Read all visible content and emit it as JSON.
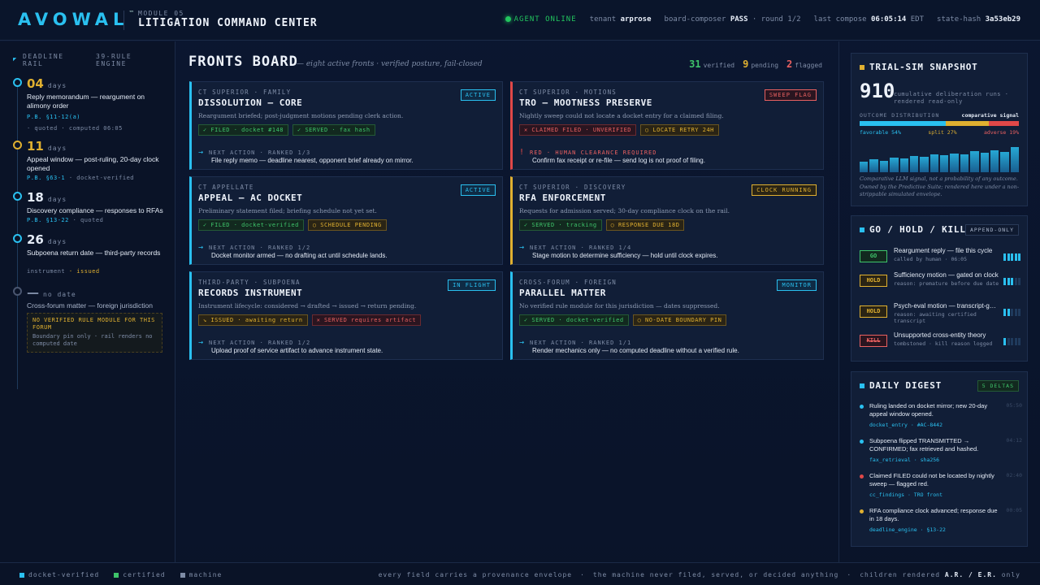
{
  "header": {
    "logo": "AVOWAL",
    "logo_mark": "™",
    "module": "MODULE 05",
    "title": "LITIGATION COMMAND CENTER",
    "agent_status": "AGENT ONLINE",
    "tenant_label": "tenant",
    "tenant": "arprose",
    "composer_label": "board-composer",
    "composer": "PASS",
    "round": "· round 1/2",
    "compose_label": "last compose",
    "compose_time": "06:05:14",
    "compose_tz": "EDT",
    "hash_label": "state-hash",
    "hash": "3a53eb29"
  },
  "rail": {
    "label_a": "DEADLINE RAIL",
    "label_b": "39-RULE ENGINE",
    "deadlines": [
      {
        "days": "04",
        "unit": "days",
        "color": "#e0b030",
        "node": "#2ac0f0",
        "title": "Reply memorandum — reargument on alimony order",
        "rule": "P.B. §11-12(a)",
        "meta": "· quoted · computed 06:05"
      },
      {
        "days": "11",
        "unit": "days",
        "color": "#e0b030",
        "node": "#e0b030",
        "title": "Appeal window — post-ruling, 20-day clock opened",
        "rule": "P.B. §63-1",
        "meta": "· docket-verified"
      },
      {
        "days": "18",
        "unit": "days",
        "color": "#e4ebf6",
        "node": "#2ac0f0",
        "title": "Discovery compliance — responses to RFAs",
        "rule": "P.B. §13-22",
        "meta": "· quoted"
      },
      {
        "days": "26",
        "unit": "days",
        "color": "#e4ebf6",
        "node": "#2ac0f0",
        "title": "Subpoena return date — third-party records",
        "rule": "instrument",
        "meta": "· issued"
      }
    ],
    "nodate": {
      "dash": "—",
      "unit": "no date",
      "title": "Cross-forum matter — foreign jurisdiction",
      "box_title": "NO VERIFIED RULE MODULE FOR THIS FORUM",
      "box_sub": "Boundary pin only · rail renders no computed date"
    }
  },
  "board": {
    "title": "FRONTS BOARD",
    "subtitle": "— eight active fronts · verified posture, fail-closed",
    "verified_n": "31",
    "verified_l": "verified",
    "pending_n": "9",
    "pending_l": "pending",
    "flagged_n": "2",
    "flagged_l": "flagged",
    "cards": [
      {
        "court": "CT SUPERIOR · FAMILY",
        "name": "DISSOLUTION — CORE",
        "badge": "ACTIVE",
        "desc": "Reargument briefed; post-judgment motions pending clerk action.",
        "chip1": "✓ FILED · docket #148",
        "chip2": "✓ SERVED · fax hash",
        "na": "NEXT ACTION · RANKED 1/3",
        "next": "File reply memo — deadline nearest, opponent brief already on mirror."
      },
      {
        "court": "CT SUPERIOR · MOTIONS",
        "name": "TRO — MOOTNESS PRESERVE",
        "badge": "SWEEP FLAG",
        "desc": "Nightly sweep could not locate a docket entry for a claimed filing.",
        "chip1": "✕ CLAIMED FILED · UNVERIFIED",
        "chip2": "○ LOCATE RETRY 24H",
        "na": "RED · HUMAN CLEARANCE REQUIRED",
        "next": "Confirm fax receipt or re-file — send log is not proof of filing."
      },
      {
        "court": "CT APPELLATE",
        "name": "APPEAL — AC DOCKET",
        "badge": "ACTIVE",
        "desc": "Preliminary statement filed; briefing schedule not yet set.",
        "chip1": "✓ FILED · docket-verified",
        "chip2": "○ SCHEDULE PENDING",
        "na": "NEXT ACTION · RANKED 1/2",
        "next": "Docket monitor armed — no drafting act until schedule lands."
      },
      {
        "court": "CT SUPERIOR · DISCOVERY",
        "name": "RFA ENFORCEMENT",
        "badge": "CLOCK RUNNING",
        "desc": "Requests for admission served; 30-day compliance clock on the rail.",
        "chip1": "✓ SERVED · tracking",
        "chip2": "○ RESPONSE DUE 18D",
        "na": "NEXT ACTION · RANKED 1/4",
        "next": "Stage motion to determine sufficiency — hold until clock expires."
      },
      {
        "court": "THIRD-PARTY · SUBPOENA",
        "name": "RECORDS INSTRUMENT",
        "badge": "IN FLIGHT",
        "desc": "Instrument lifecycle: considered → drafted → issued → return pending.",
        "chip1": "↘ ISSUED · awaiting return",
        "chip2": "✕ SERVED requires artifact",
        "na": "NEXT ACTION · RANKED 1/2",
        "next": "Upload proof of service artifact to advance instrument state."
      },
      {
        "court": "CROSS-FORUM · FOREIGN",
        "name": "PARALLEL MATTER",
        "badge": "MONITOR",
        "desc": "No verified rule module for this jurisdiction — dates suppressed.",
        "chip1": "✓ SERVED · docket-verified",
        "chip2": "○ NO-DATE BOUNDARY PIN",
        "na": "NEXT ACTION · RANKED 1/1",
        "next": "Render mechanics only — no computed deadline without a verified rule."
      }
    ]
  },
  "trial_sim": {
    "title": "TRIAL-SIM SNAPSHOT",
    "runs": "910",
    "runs_label": "cumulative deliberation runs · rendered read-only",
    "dist_label": "OUTCOME DISTRIBUTION",
    "signal": "comparative signal",
    "favorable": "favorable 54%",
    "split": "split 27%",
    "adverse": "adverse 19%",
    "fav_pct": 54,
    "split_pct": 27,
    "adv_pct": 19,
    "spark": [
      0.35,
      0.45,
      0.4,
      0.5,
      0.48,
      0.55,
      0.52,
      0.6,
      0.58,
      0.65,
      0.62,
      0.72,
      0.68,
      0.75,
      0.7,
      0.85
    ],
    "note": "Comparative LLM signal, not a probability of any outcome. Owned by the Predictive Suite; rendered here under a non-strippable simulated envelope."
  },
  "levers": {
    "title": "GO / HOLD / KILL LEVERS",
    "badge": "APPEND-ONLY",
    "items": [
      {
        "state": "GO",
        "cls": "lb-go",
        "title": "Reargument reply — file this cycle",
        "sub": "called by human · 06:05",
        "level": 5
      },
      {
        "state": "HOLD",
        "cls": "lb-hold",
        "title": "Sufficiency motion — gated on clock",
        "sub": "reason: premature before due date",
        "level": 3
      },
      {
        "state": "HOLD",
        "cls": "lb-hold",
        "title": "Psych-eval motion — transcript-gated",
        "sub": "reason: awaiting certified transcript",
        "level": 2
      },
      {
        "state": "KILL",
        "cls": "lb-kill",
        "title": "Unsupported cross-entity theory",
        "sub": "tombstoned · kill reason logged",
        "level": 1
      }
    ]
  },
  "digest": {
    "title": "DAILY DIGEST",
    "badge": "5 DELTAS",
    "items": [
      {
        "color": "#2ac0f0",
        "text": "Ruling landed on docket mirror; new 20-day appeal window opened.",
        "time": "05:50",
        "src": "docket_entry · #AC-8442"
      },
      {
        "color": "#2ac0f0",
        "text": "Subpoena flipped TRANSMITTED → CONFIRMED; fax retrieved and hashed.",
        "time": "04:12",
        "src": "fax_retrieval · sha256"
      },
      {
        "color": "#e04848",
        "text": "Claimed FILED could not be located by nightly sweep — flagged red.",
        "time": "02:40",
        "src": "cc_findings · TRO front"
      },
      {
        "color": "#e0b030",
        "text": "RFA compliance clock advanced; response due in 18 days.",
        "time": "00:05",
        "src": "deadline_engine · §13-22"
      }
    ]
  },
  "footer": {
    "legend": [
      {
        "label": "docket-verified",
        "color": "#2ac0f0"
      },
      {
        "label": "certified",
        "color": "#3ec46a"
      },
      {
        "label": "machine",
        "color": "#7e8ca6"
      }
    ],
    "note1": "every field carries a provenance envelope",
    "note2": "the machine never filed, served, or decided anything",
    "note3a": "children rendered",
    "note3b": "A.R. / E.R.",
    "note3c": "only",
    "sep": "·"
  }
}
